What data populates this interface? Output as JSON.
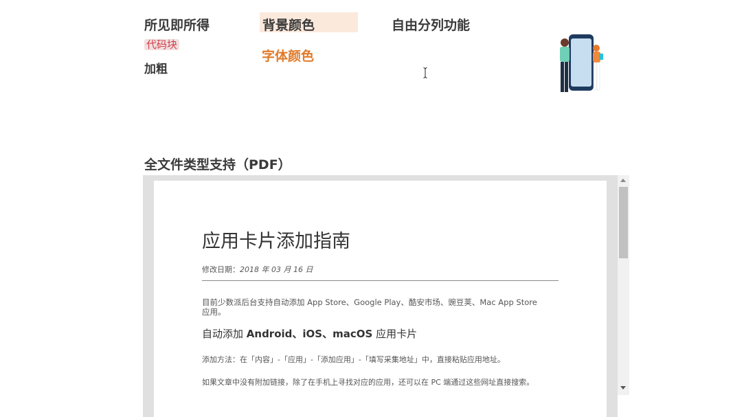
{
  "features": {
    "wysiwyg": "所见即所得",
    "background_color": "背景颜色",
    "column_split": "自由分列功能",
    "code_block": "代码块",
    "bold": "加粗",
    "font_color": "字体颜色"
  },
  "section": {
    "title": "全文件类型支持（PDF）"
  },
  "document": {
    "title": "应用卡片添加指南",
    "date_label": "修改日期：",
    "date_value": "2018 年  03 月  16 日",
    "intro": "目前少数派后台支持自动添加 App Store、Google Play、酷安市场、豌豆荚、Mac App Store 应用。",
    "subheading_prefix": "自动添加 ",
    "subheading_platforms": "Android、iOS、macOS",
    "subheading_suffix": " 应用卡片",
    "method": "添加方法：在「内容」-「应用」-「添加应用」-「填写采集地址」中，直接粘贴应用地址。",
    "note": "如果文章中没有附加链接，除了在手机上寻找对应的应用，还可以在 PC 端通过这些网址直接搜索。"
  },
  "colors": {
    "background_highlight": "#fbe9dc",
    "font_color_orange": "#e07b2a",
    "code_text": "#d0404a",
    "code_bg": "#f2dfe0",
    "viewer_bg": "#e0e0e0"
  }
}
